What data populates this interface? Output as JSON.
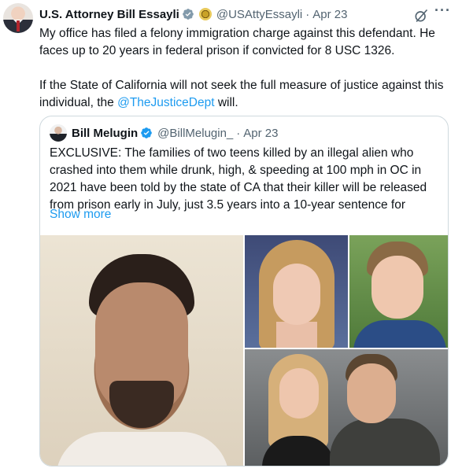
{
  "tweet": {
    "author_name": "U.S. Attorney Bill Essayli",
    "handle": "@USAttyEssayli",
    "separator": "·",
    "time": "Apr 23",
    "paragraph1": "My office has filed a felony immigration charge against this defendant. He faces up to 20 years in federal prison if convicted for 8 USC 1326.",
    "paragraph2_before": "If the State of California will not seek the full measure of justice against this individual, the ",
    "paragraph2_mention": "@TheJusticeDept",
    "paragraph2_after": " will."
  },
  "quoted_tweet": {
    "author_name": "Bill Melugin",
    "handle": "@BillMelugin_",
    "separator": "·",
    "time": "Apr 23",
    "text": "EXCLUSIVE: The families of two teens killed by an illegal alien who crashed into them while drunk, high, & speeding at 100 mph in OC in 2021 have been told by the state of CA that their killer will be released from prison early in July, just 3.5 years into a 10-year sentence for",
    "show_more": "Show more"
  },
  "icons": {
    "verified": "verified-badge-icon",
    "government": "government-seal-icon",
    "grok": "grok-icon",
    "more": "more-options-icon"
  },
  "colors": {
    "accent": "#1d9bf0",
    "text": "#0f1419",
    "secondary": "#536471",
    "border": "#cfd9de"
  }
}
